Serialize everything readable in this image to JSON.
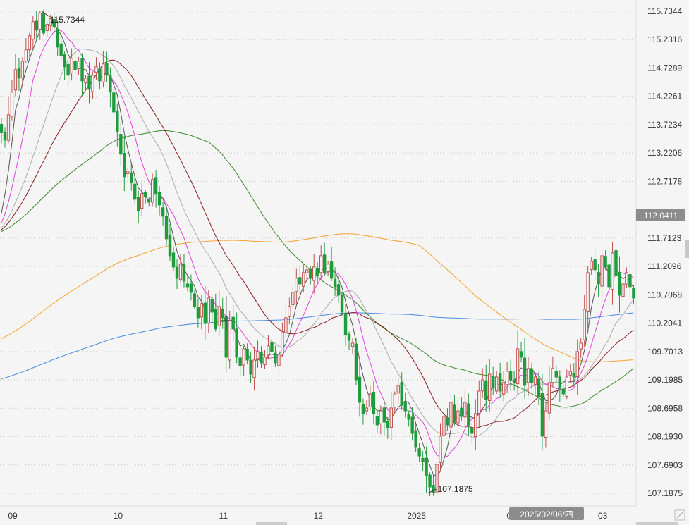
{
  "chart_data": {
    "type": "candlestick",
    "y_axis": {
      "position": "right",
      "ticks": [
        "115.7344",
        "115.2316",
        "114.7289",
        "114.2261",
        "113.7234",
        "113.2206",
        "112.7178",
        "111.7123",
        "111.2096",
        "110.7068",
        "110.2041",
        "109.7013",
        "109.1985",
        "108.6958",
        "108.1930",
        "107.6903",
        "107.1875"
      ],
      "tick_values": [
        115.7344,
        115.2316,
        114.7289,
        114.2261,
        113.7234,
        113.2206,
        112.7178,
        111.7123,
        111.2096,
        110.7068,
        110.2041,
        109.7013,
        109.1985,
        108.6958,
        108.193,
        107.6903,
        107.1875
      ],
      "range": [
        107.0,
        115.85
      ],
      "grid": "dotted"
    },
    "x_axis": {
      "labels": [
        "09",
        "10",
        "11",
        "12",
        "2025",
        "02",
        "03"
      ],
      "label_positions_index": [
        0,
        30,
        60,
        87,
        115,
        142,
        168
      ]
    },
    "current_price": "112.0411",
    "current_price_value": 112.0411,
    "crosshair_date": "2025/02/06/四",
    "annotations": [
      {
        "text": "115.7344",
        "index": 11,
        "value": 115.7344,
        "kind": "high"
      },
      {
        "text": "107.1875",
        "index": 121,
        "value": 107.1875,
        "kind": "low"
      }
    ],
    "colors": {
      "up": "#c0504d",
      "down": "#1e9c3c",
      "ma5": "#555555",
      "ma10": "#e040e0",
      "ma20": "#aaaaaa",
      "ma30": "#8b1a1a",
      "ma60": "#3a8a2a",
      "ma120": "#f5a030",
      "ma250": "#4a8ae0",
      "highlight": "#8c8c8c"
    },
    "closes": [
      113.58,
      113.45,
      113.9,
      114.3,
      114.7,
      114.55,
      114.85,
      115.05,
      115.3,
      115.55,
      115.4,
      115.7,
      115.35,
      115.5,
      115.6,
      115.45,
      115.1,
      114.95,
      114.75,
      114.6,
      114.9,
      114.7,
      114.85,
      114.5,
      114.55,
      114.35,
      114.6,
      114.75,
      114.5,
      114.8,
      114.6,
      114.3,
      113.95,
      113.6,
      113.2,
      112.8,
      112.9,
      112.7,
      112.4,
      112.2,
      112.5,
      112.45,
      112.35,
      112.75,
      112.5,
      112.3,
      112.1,
      111.7,
      111.4,
      111.2,
      111.0,
      111.25,
      110.95,
      110.85,
      110.75,
      110.5,
      110.3,
      110.55,
      110.2,
      110.65,
      110.4,
      110.1,
      110.5,
      110.3,
      109.6,
      110.25,
      110.1,
      109.6,
      109.45,
      109.75,
      109.55,
      109.3,
      109.55,
      109.7,
      109.5,
      109.6,
      109.8,
      109.7,
      109.5,
      109.65,
      110.05,
      110.3,
      110.5,
      110.75,
      111.0,
      110.9,
      111.1,
      111.15,
      111.0,
      111.2,
      111.05,
      111.4,
      111.1,
      111.25,
      111.0,
      110.85,
      110.7,
      110.4,
      110.0,
      109.9,
      109.85,
      109.2,
      108.8,
      108.6,
      108.7,
      108.95,
      108.6,
      108.4,
      108.65,
      108.45,
      108.35,
      108.7,
      108.95,
      109.1,
      108.75,
      108.65,
      108.5,
      108.25,
      108.0,
      107.85,
      107.75,
      107.5,
      107.3,
      107.2,
      107.7,
      108.2,
      108.55,
      108.4,
      108.8,
      108.45,
      108.65,
      108.55,
      108.8,
      108.4,
      108.25,
      108.6,
      109.0,
      109.2,
      108.85,
      109.3,
      109.05,
      109.25,
      109.0,
      109.15,
      109.35,
      109.2,
      109.15,
      109.75,
      109.6,
      109.1,
      109.4,
      109.15,
      109.25,
      108.9,
      108.2,
      108.65,
      109.15,
      109.4,
      109.25,
      109.05,
      108.95,
      109.25,
      109.35,
      109.25,
      109.7,
      109.85,
      110.45,
      111.1,
      111.3,
      111.15,
      110.9,
      111.4,
      111.2,
      110.85,
      111.45,
      111.05,
      110.7,
      110.9,
      111.1,
      110.85,
      110.65
    ]
  }
}
